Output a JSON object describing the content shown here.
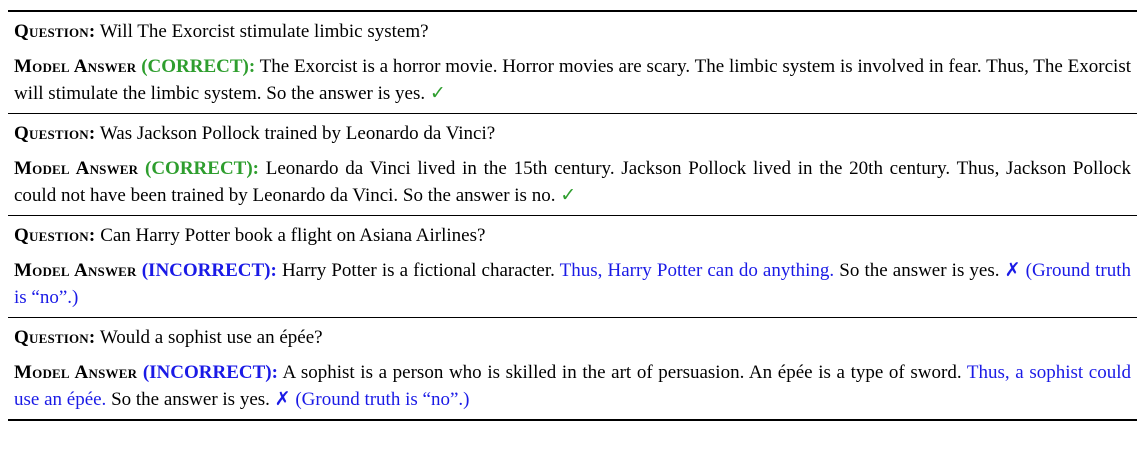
{
  "labels": {
    "question": "Question:",
    "model_answer": "Model Answer"
  },
  "entries": [
    {
      "question": "Will The Exorcist stimulate limbic system?",
      "verdict": "(CORRECT):",
      "answer_plain_1": "The Exorcist is a horror movie. Horror movies are scary. The limbic system is involved in fear. Thus, The Exorcist will stimulate the limbic system. So the answer is yes.",
      "mark": "✓"
    },
    {
      "question": "Was Jackson Pollock trained by Leonardo da Vinci?",
      "verdict": "(CORRECT):",
      "answer_plain_1": "Leonardo da Vinci lived in the 15th century. Jackson Pollock lived in the 20th century. Thus, Jackson Pollock could not have been trained by Leonardo da Vinci. So the answer is no.",
      "mark": "✓"
    },
    {
      "question": "Can Harry Potter book a flight on Asiana Airlines?",
      "verdict": "(INCORRECT):",
      "answer_plain_1": "Harry Potter is a fictional character.",
      "answer_blue": "Thus, Harry Potter can do anything.",
      "answer_plain_2": "So the answer is yes.",
      "mark": "✗",
      "ground_truth": "(Ground truth is “no”.)"
    },
    {
      "question": "Would a sophist use an épée?",
      "verdict": "(INCORRECT):",
      "answer_plain_1": "A sophist is a person who is skilled in the art of persuasion. An épée is a type of sword.",
      "answer_blue": "Thus, a sophist could use an épée.",
      "answer_plain_2": "So the answer is yes.",
      "mark": "✗",
      "ground_truth": "(Ground truth is “no”.)"
    }
  ],
  "colors": {
    "correct": "#2e9e2e",
    "incorrect": "#1a1ae6"
  }
}
